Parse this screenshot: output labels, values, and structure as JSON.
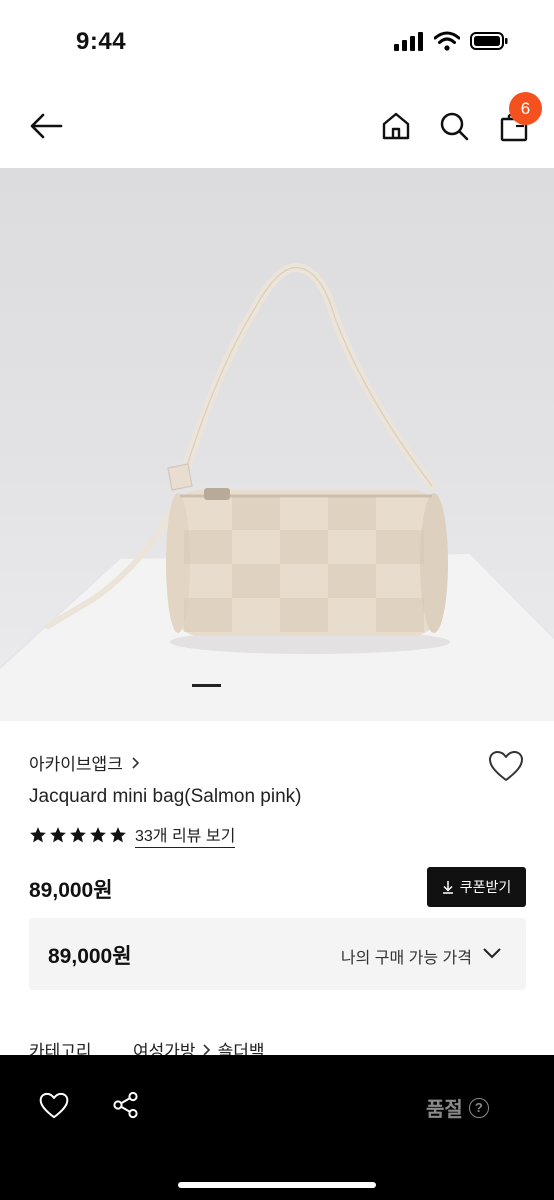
{
  "status_bar": {
    "time": "9:44"
  },
  "nav": {
    "cart_count": "6"
  },
  "product": {
    "brand": "아카이브앱크",
    "name": "Jacquard mini bag(Salmon pink)",
    "rating_stars": 5,
    "review_link": "33개 리뷰 보기",
    "price": "89,000원",
    "coupon_label": "쿠폰받기",
    "my_price": "89,000원",
    "my_price_label": "나의 구매 가능 가격",
    "category_label": "카테고리",
    "category_level1": "여성가방",
    "category_level2": "숄더백"
  },
  "bottom_bar": {
    "soldout_label": "품절",
    "help_mark": "?"
  },
  "colors": {
    "badge": "#f4511e",
    "bottom_bar": "#000000",
    "soldout_text": "#8a8a8a"
  }
}
